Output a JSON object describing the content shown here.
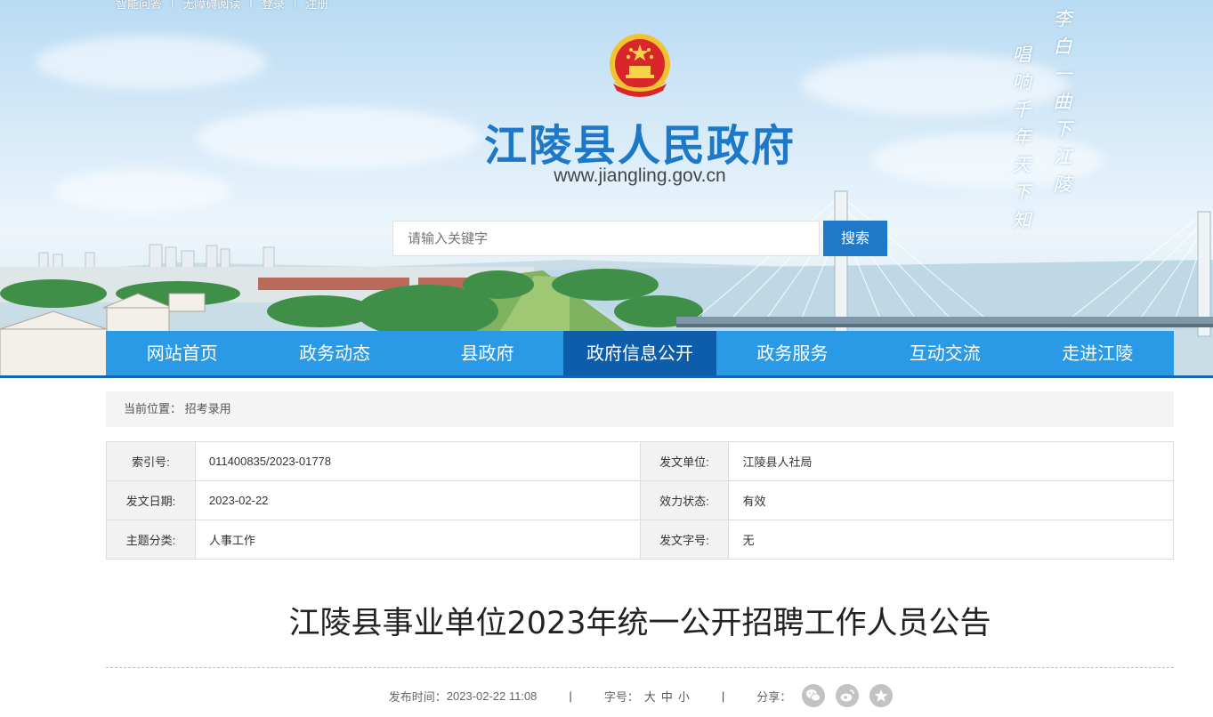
{
  "topbar": {
    "links": [
      "智能问答",
      "无障碍阅读",
      "登录",
      "注册"
    ]
  },
  "header": {
    "site_title": "江陵县人民政府",
    "site_url": "www.jiangling.gov.cn",
    "poem_right": "李白一曲下江陵",
    "poem_left": "唱响千年天下知"
  },
  "search": {
    "placeholder": "请输入关键字",
    "button_label": "搜索"
  },
  "nav": {
    "items": [
      {
        "label": "网站首页"
      },
      {
        "label": "政务动态"
      },
      {
        "label": "县政府"
      },
      {
        "label": "政府信息公开"
      },
      {
        "label": "政务服务"
      },
      {
        "label": "互动交流"
      },
      {
        "label": "走进江陵"
      }
    ],
    "active_index": 3
  },
  "breadcrumb": {
    "prefix": "当前位置：",
    "current": "招考录用"
  },
  "info": {
    "rows": [
      [
        {
          "label": "索引号:",
          "value": "011400835/2023-01778"
        },
        {
          "label": "发文单位:",
          "value": "江陵县人社局"
        }
      ],
      [
        {
          "label": "发文日期:",
          "value": "2023-02-22"
        },
        {
          "label": "效力状态:",
          "value": "有效"
        }
      ],
      [
        {
          "label": "主题分类:",
          "value": "人事工作"
        },
        {
          "label": "发文字号:",
          "value": "无"
        }
      ]
    ]
  },
  "article": {
    "title": "江陵县事业单位2023年统一公开招聘工作人员公告",
    "publish_label": "发布时间：",
    "publish_time": "2023-02-22 11:08",
    "separator": "|",
    "font_label": "字号：",
    "font_large": "大",
    "font_medium": "中",
    "font_small": "小",
    "share_label": "分享："
  },
  "colors": {
    "brand_blue": "#1e78c8",
    "nav_blue": "#2a9ae6",
    "nav_active": "#0d5dab"
  },
  "icons": [
    "national-emblem-icon",
    "wechat-icon",
    "weibo-icon",
    "favorite-star-icon"
  ]
}
